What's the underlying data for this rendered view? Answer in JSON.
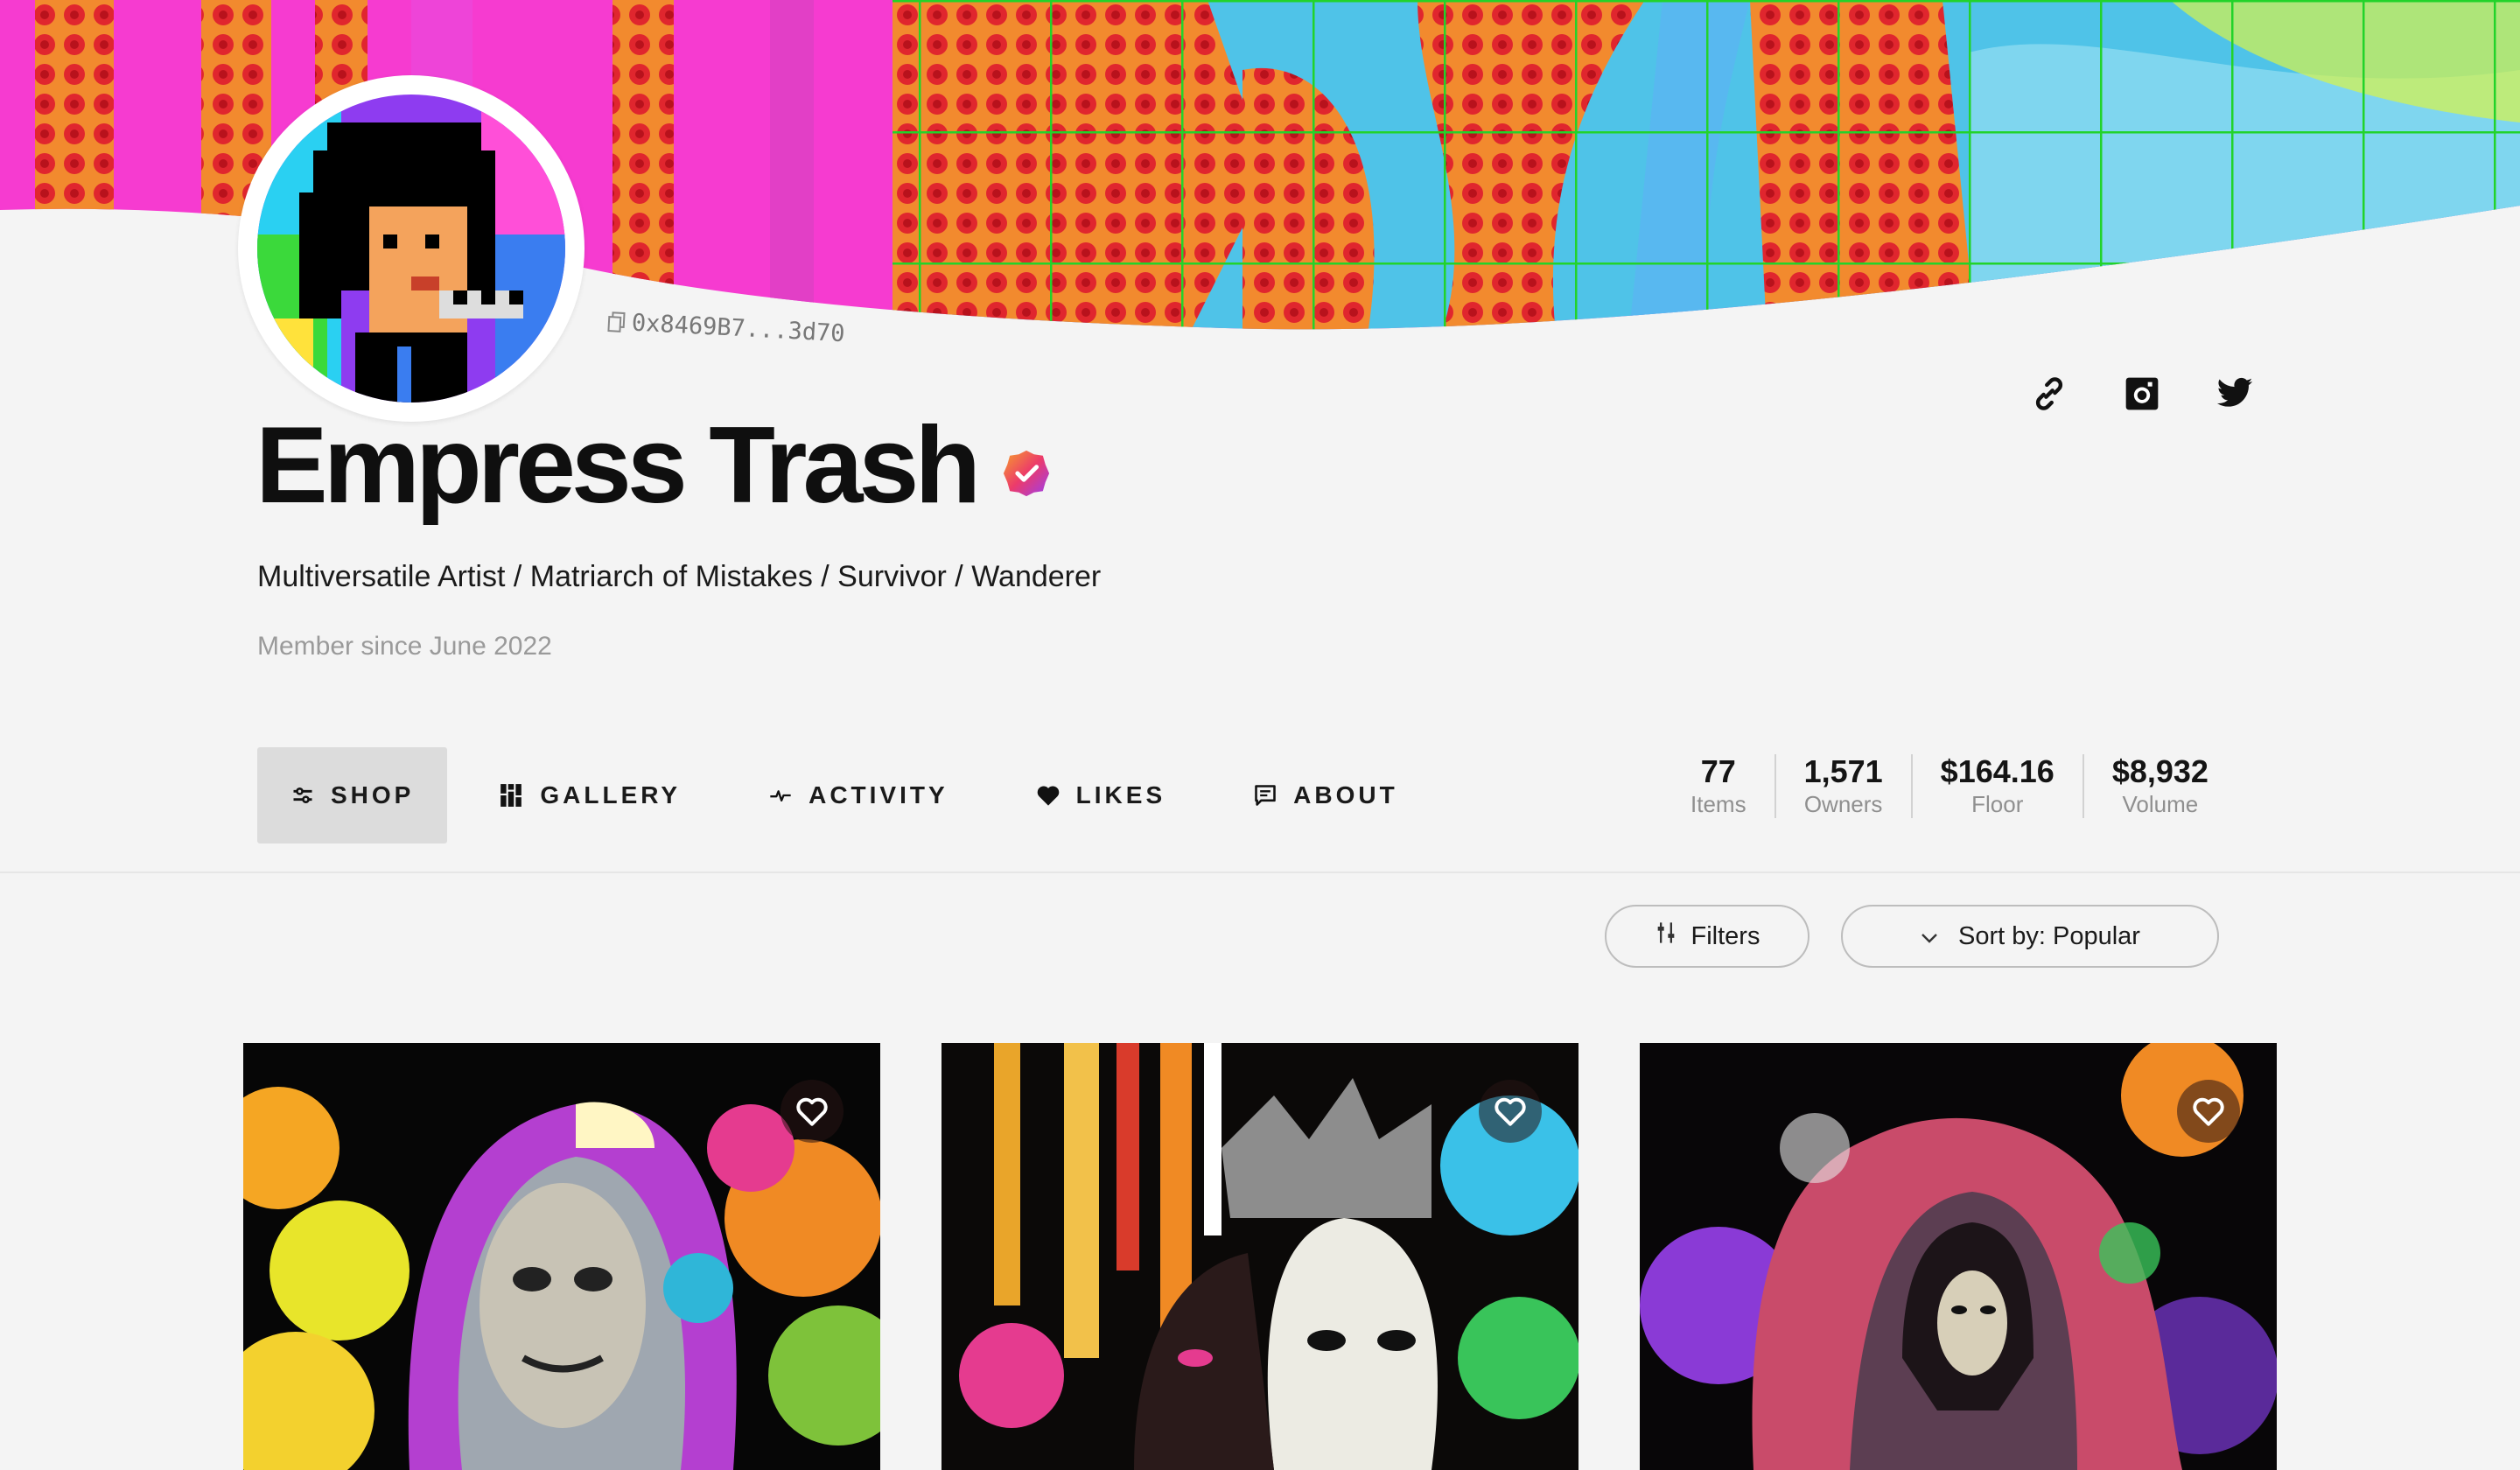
{
  "profile": {
    "name": "Empress Trash",
    "address": "0x8469B7...3d70",
    "bio": "Multiversatile Artist / Matriarch of Mistakes / Survivor / Wanderer",
    "member_since": "Member since June 2022",
    "verified": true
  },
  "socials": [
    {
      "icon": "link-icon"
    },
    {
      "icon": "instagram-icon"
    },
    {
      "icon": "twitter-icon"
    }
  ],
  "tabs": [
    {
      "label": "SHOP",
      "icon": "sliders-icon",
      "active": true
    },
    {
      "label": "GALLERY",
      "icon": "grid-icon",
      "active": false
    },
    {
      "label": "ACTIVITY",
      "icon": "pulse-icon",
      "active": false
    },
    {
      "label": "LIKES",
      "icon": "heart-icon",
      "active": false
    },
    {
      "label": "ABOUT",
      "icon": "message-icon",
      "active": false
    }
  ],
  "stats": [
    {
      "value": "77",
      "label": "Items"
    },
    {
      "value": "1,571",
      "label": "Owners"
    },
    {
      "value": "$164.16",
      "label": "Floor"
    },
    {
      "value": "$8,932",
      "label": "Volume"
    }
  ],
  "toolbar": {
    "filters_label": "Filters",
    "sort_label": "Sort by: Popular"
  },
  "colors": {
    "background": "#f4f4f4",
    "active_tab": "#dcdcdc",
    "verified_badge": "#e8336d"
  },
  "cards": [
    {
      "liked": false
    },
    {
      "liked": false
    },
    {
      "liked": false
    }
  ]
}
